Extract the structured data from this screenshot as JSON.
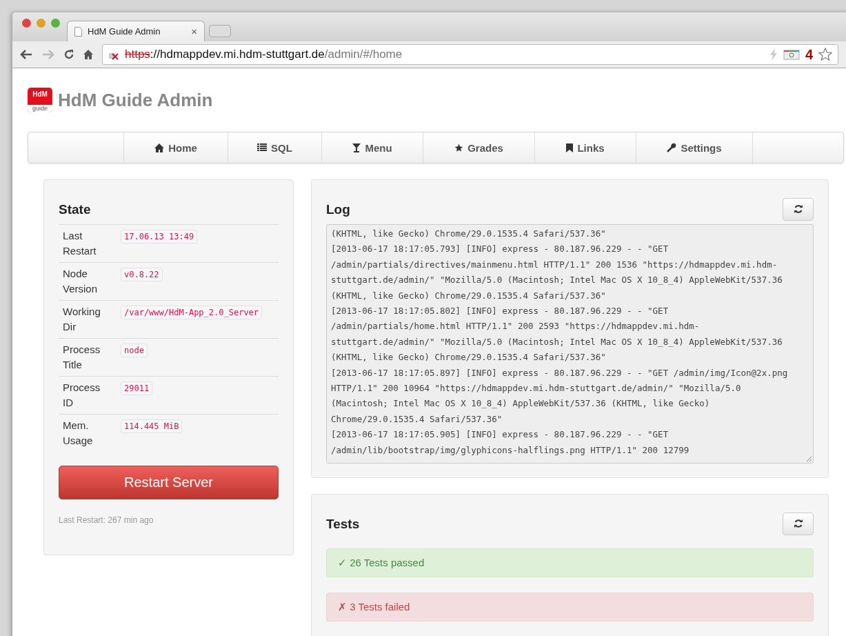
{
  "browser": {
    "tab": {
      "title": "HdM Guide Admin",
      "close": "×"
    },
    "url": {
      "scheme": "https",
      "host": "://hdmappdev.mi.hdm-stuttgart.de",
      "path": "/admin/#/home"
    },
    "extension_badge": "4"
  },
  "app": {
    "logo": {
      "top": "HdM",
      "bottom": "guide"
    },
    "title": "HdM Guide Admin"
  },
  "nav": [
    {
      "label": "Home"
    },
    {
      "label": "SQL"
    },
    {
      "label": "Menu"
    },
    {
      "label": "Grades"
    },
    {
      "label": "Links"
    },
    {
      "label": "Settings"
    }
  ],
  "state": {
    "title": "State",
    "rows": [
      {
        "label": "Last Restart",
        "value": "17.06.13 13:49"
      },
      {
        "label": "Node Version",
        "value": "v0.8.22"
      },
      {
        "label": "Working Dir",
        "value": "/var/www/HdM-App_2.0_Server"
      },
      {
        "label": "Process Title",
        "value": "node"
      },
      {
        "label": "Process ID",
        "value": "29011"
      },
      {
        "label": "Mem. Usage",
        "value": "114.445 MiB"
      }
    ],
    "button": "Restart Server",
    "footer": "Last Restart: 267 min ago"
  },
  "log": {
    "title": "Log",
    "lines": [
      "(KHTML, like Gecko) Chrome/29.0.1535.4 Safari/537.36\"",
      "[2013-06-17 18:17:05.793] [INFO] express - 80.187.96.229 - - \"GET",
      "/admin/partials/directives/mainmenu.html HTTP/1.1\" 200 1536 \"https://hdmappdev.mi.hdm-",
      "stuttgart.de/admin/\" \"Mozilla/5.0 (Macintosh; Intel Mac OS X 10_8_4) AppleWebKit/537.36",
      "(KHTML, like Gecko) Chrome/29.0.1535.4 Safari/537.36\"",
      "[2013-06-17 18:17:05.802] [INFO] express - 80.187.96.229 - - \"GET",
      "/admin/partials/home.html HTTP/1.1\" 200 2593 \"https://hdmappdev.mi.hdm-",
      "stuttgart.de/admin/\" \"Mozilla/5.0 (Macintosh; Intel Mac OS X 10_8_4) AppleWebKit/537.36",
      "(KHTML, like Gecko) Chrome/29.0.1535.4 Safari/537.36\"",
      "[2013-06-17 18:17:05.897] [INFO] express - 80.187.96.229 - - \"GET /admin/img/Icon@2x.png",
      "HTTP/1.1\" 200 10964 \"https://hdmappdev.mi.hdm-stuttgart.de/admin/\" \"Mozilla/5.0",
      "(Macintosh; Intel Mac OS X 10_8_4) AppleWebKit/537.36 (KHTML, like Gecko)",
      "Chrome/29.0.1535.4 Safari/537.36\"",
      "[2013-06-17 18:17:05.905] [INFO] express - 80.187.96.229 - - \"GET",
      "/admin/lib/bootstrap/img/glyphicons-halflings.png HTTP/1.1\" 200 12799"
    ]
  },
  "tests": {
    "title": "Tests",
    "results": [
      {
        "kind": "passed",
        "text": "✓ 26 Tests passed"
      },
      {
        "kind": "failed",
        "text": "✗ 3 Tests failed"
      }
    ]
  }
}
